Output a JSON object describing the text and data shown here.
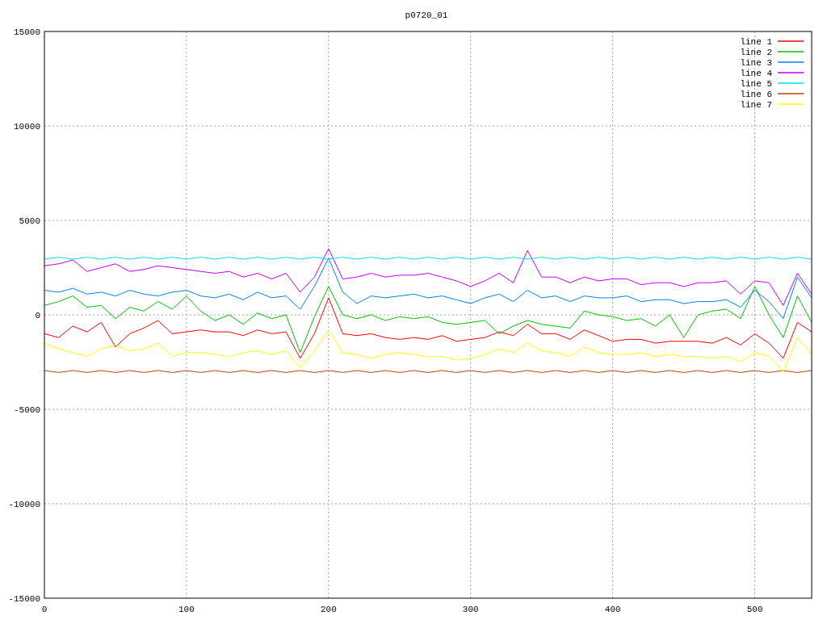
{
  "chart": {
    "chart_data": {
      "type": "line",
      "title": "p0720_01",
      "grid": true,
      "legend": true,
      "xlim": [
        0,
        540
      ],
      "ylim": [
        -15000,
        15000
      ],
      "xticks": [
        0,
        100,
        200,
        300,
        400,
        500
      ],
      "yticks": [
        -15000,
        -10000,
        -5000,
        0,
        5000,
        10000,
        15000
      ],
      "x": [
        0,
        10,
        20,
        30,
        40,
        50,
        60,
        70,
        80,
        90,
        100,
        110,
        120,
        130,
        140,
        150,
        160,
        170,
        180,
        190,
        200,
        210,
        220,
        230,
        240,
        250,
        260,
        270,
        280,
        290,
        300,
        310,
        320,
        330,
        340,
        350,
        360,
        370,
        380,
        390,
        400,
        410,
        420,
        430,
        440,
        450,
        460,
        470,
        480,
        490,
        500,
        510,
        520,
        530,
        540
      ],
      "series": [
        {
          "name": "line 1",
          "color": "#ff0000",
          "values": [
            -1000,
            -1200,
            -600,
            -900,
            -400,
            -1700,
            -1000,
            -700,
            -300,
            -1000,
            -900,
            -800,
            -900,
            -900,
            -1100,
            -800,
            -1000,
            -900,
            -2300,
            -1000,
            900,
            -1000,
            -1100,
            -1000,
            -1200,
            -1300,
            -1200,
            -1300,
            -1100,
            -1400,
            -1300,
            -1200,
            -900,
            -1100,
            -500,
            -1000,
            -1000,
            -1300,
            -800,
            -1100,
            -1400,
            -1300,
            -1300,
            -1500,
            -1400,
            -1400,
            -1400,
            -1500,
            -1200,
            -1600,
            -1000,
            -1500,
            -2300,
            -400,
            -900
          ]
        },
        {
          "name": "line 2",
          "color": "#00c000",
          "values": [
            500,
            700,
            1000,
            400,
            500,
            -200,
            400,
            200,
            700,
            300,
            1000,
            200,
            -300,
            0,
            -500,
            100,
            -200,
            0,
            -2000,
            -100,
            1500,
            0,
            -200,
            0,
            -300,
            -100,
            -200,
            -100,
            -400,
            -500,
            -400,
            -300,
            -1000,
            -600,
            -300,
            -500,
            -600,
            -700,
            200,
            0,
            -100,
            -300,
            -200,
            -600,
            0,
            -1200,
            0,
            200,
            300,
            -200,
            1500,
            0,
            -1200,
            1000,
            -400
          ]
        },
        {
          "name": "line 3",
          "color": "#0080ff",
          "values": [
            1300,
            1200,
            1400,
            1100,
            1200,
            1000,
            1300,
            1100,
            1000,
            1200,
            1300,
            1000,
            900,
            1100,
            800,
            1200,
            900,
            1000,
            300,
            1500,
            3000,
            1200,
            600,
            1000,
            900,
            1000,
            1100,
            900,
            1000,
            800,
            600,
            900,
            1100,
            700,
            1300,
            900,
            1000,
            700,
            1000,
            900,
            900,
            1000,
            700,
            800,
            800,
            600,
            700,
            700,
            800,
            400,
            1300,
            700,
            -200,
            2000,
            900
          ]
        },
        {
          "name": "line 4",
          "color": "#c000ff",
          "values": [
            2600,
            2700,
            2900,
            2300,
            2500,
            2700,
            2300,
            2400,
            2600,
            2500,
            2400,
            2300,
            2200,
            2300,
            2000,
            2200,
            1900,
            2200,
            1200,
            2000,
            3500,
            1900,
            2000,
            2200,
            2000,
            2100,
            2100,
            2200,
            2000,
            1800,
            1500,
            1800,
            2200,
            1700,
            3400,
            2000,
            2000,
            1700,
            2000,
            1800,
            1900,
            1900,
            1600,
            1700,
            1700,
            1500,
            1700,
            1700,
            1800,
            1100,
            1800,
            1700,
            500,
            2200,
            1100
          ]
        },
        {
          "name": "line 5",
          "color": "#00e0e0",
          "values": [
            2950,
            3050,
            2950,
            3050,
            2950,
            3050,
            2950,
            3050,
            2950,
            3050,
            2950,
            3050,
            2950,
            3050,
            2950,
            3050,
            2950,
            3050,
            2950,
            3050,
            2950,
            3050,
            2950,
            3050,
            2950,
            3050,
            2950,
            3050,
            2950,
            3050,
            2950,
            3050,
            2950,
            3050,
            2950,
            3050,
            2950,
            3050,
            2950,
            3050,
            2950,
            3050,
            2950,
            3050,
            2950,
            3050,
            2950,
            3050,
            2950,
            3050,
            2950,
            3050,
            2950,
            3050,
            2950
          ]
        },
        {
          "name": "line 6",
          "color": "#c04000",
          "values": [
            -2950,
            -3050,
            -2950,
            -3050,
            -2950,
            -3050,
            -2950,
            -3050,
            -2950,
            -3050,
            -2950,
            -3050,
            -2950,
            -3050,
            -2950,
            -3050,
            -2950,
            -3050,
            -2950,
            -3050,
            -2950,
            -3050,
            -2950,
            -3050,
            -2950,
            -3050,
            -2950,
            -3050,
            -2950,
            -3050,
            -2950,
            -3050,
            -2950,
            -3050,
            -2950,
            -3050,
            -2950,
            -3050,
            -2950,
            -3050,
            -2950,
            -3050,
            -2950,
            -3050,
            -2950,
            -3050,
            -2950,
            -3050,
            -2950,
            -3050,
            -2950,
            -3050,
            -2950,
            -3050,
            -2950
          ]
        },
        {
          "name": "line 7",
          "color": "#ffff00",
          "values": [
            -1500,
            -1800,
            -2000,
            -2200,
            -1800,
            -1600,
            -1900,
            -1800,
            -1500,
            -2200,
            -2000,
            -2000,
            -2100,
            -2200,
            -2000,
            -1900,
            -2100,
            -1900,
            -2800,
            -1900,
            -800,
            -2000,
            -2100,
            -2300,
            -2100,
            -2000,
            -2100,
            -2200,
            -2200,
            -2400,
            -2300,
            -2100,
            -1800,
            -2000,
            -1500,
            -1900,
            -2000,
            -2200,
            -1700,
            -2000,
            -2100,
            -2100,
            -2000,
            -2200,
            -2100,
            -2200,
            -2200,
            -2300,
            -2200,
            -2500,
            -2000,
            -2200,
            -3000,
            -1200,
            -2100
          ]
        }
      ]
    }
  }
}
